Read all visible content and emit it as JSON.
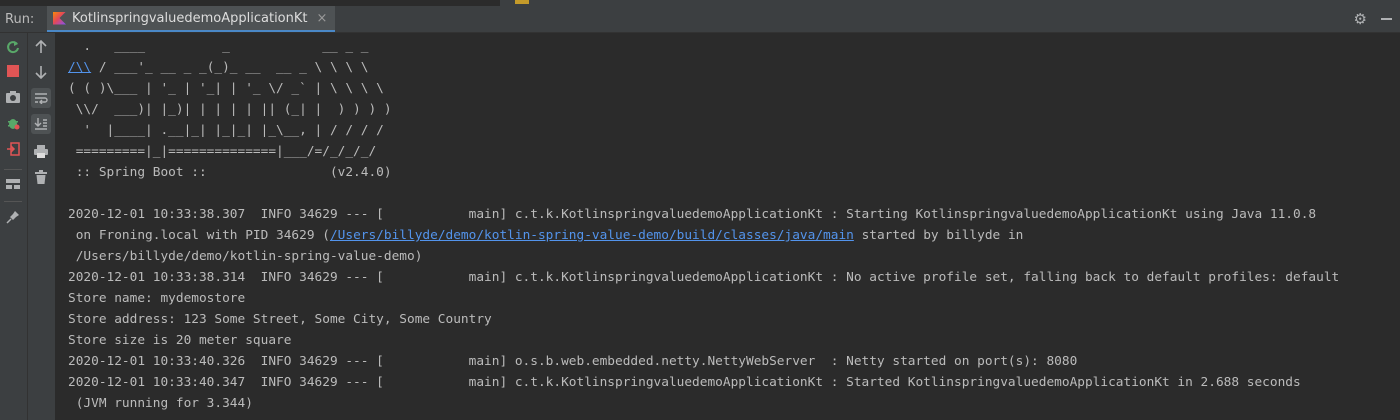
{
  "header": {
    "run_label": "Run:",
    "tab_label": "KotlinspringvaluedemoApplicationKt",
    "tab_close": "×",
    "gear": "⚙"
  },
  "toolbar": {
    "left": [
      "rerun-icon",
      "stop-icon",
      "camera-icon",
      "debug-icon",
      "exit-icon",
      "layout-icon",
      "pin-icon"
    ],
    "right": [
      "up-arrow-icon",
      "down-arrow-icon",
      "soft-wrap-icon",
      "scroll-to-end-icon",
      "print-icon",
      "trash-icon"
    ]
  },
  "banner": {
    "l1": "  .   ____          _            __ _ _",
    "l2_link": "/\\\\",
    "l2_rest": " / ___'_ __ _ _(_)_ __  __ _ \\ \\ \\ \\",
    "l3": "( ( )\\___ | '_ | '_| | '_ \\/ _` | \\ \\ \\ \\",
    "l4": " \\\\/  ___)| |_)| | | | | || (_| |  ) ) ) )",
    "l5": "  '  |____| .__|_| |_|_| |_\\__, | / / / /",
    "l6": " =========|_|==============|___/=/_/_/_/",
    "l7": " :: Spring Boot ::                (v2.4.0)"
  },
  "log": {
    "l1": "2020-12-01 10:33:38.307  INFO 34629 --- [           main] c.t.k.KotlinspringvaluedemoApplicationKt : Starting KotlinspringvaluedemoApplicationKt using Java 11.0.8",
    "l2_pre": " on Froning.local with PID 34629 (",
    "l2_link": "/Users/billyde/demo/kotlin-spring-value-demo/build/classes/java/main",
    "l2_post": " started by billyde in",
    "l3": " /Users/billyde/demo/kotlin-spring-value-demo)",
    "l4": "2020-12-01 10:33:38.314  INFO 34629 --- [           main] c.t.k.KotlinspringvaluedemoApplicationKt : No active profile set, falling back to default profiles: default",
    "l5": "Store name: mydemostore",
    "l6": "Store address: 123 Some Street, Some City, Some Country",
    "l7": "Store size is 20 meter square",
    "l8": "2020-12-01 10:33:40.326  INFO 34629 --- [           main] o.s.b.web.embedded.netty.NettyWebServer  : Netty started on port(s): 8080",
    "l9": "2020-12-01 10:33:40.347  INFO 34629 --- [           main] c.t.k.KotlinspringvaluedemoApplicationKt : Started KotlinspringvaluedemoApplicationKt in 2.688 seconds",
    "l10": " (JVM running for 3.344)"
  }
}
